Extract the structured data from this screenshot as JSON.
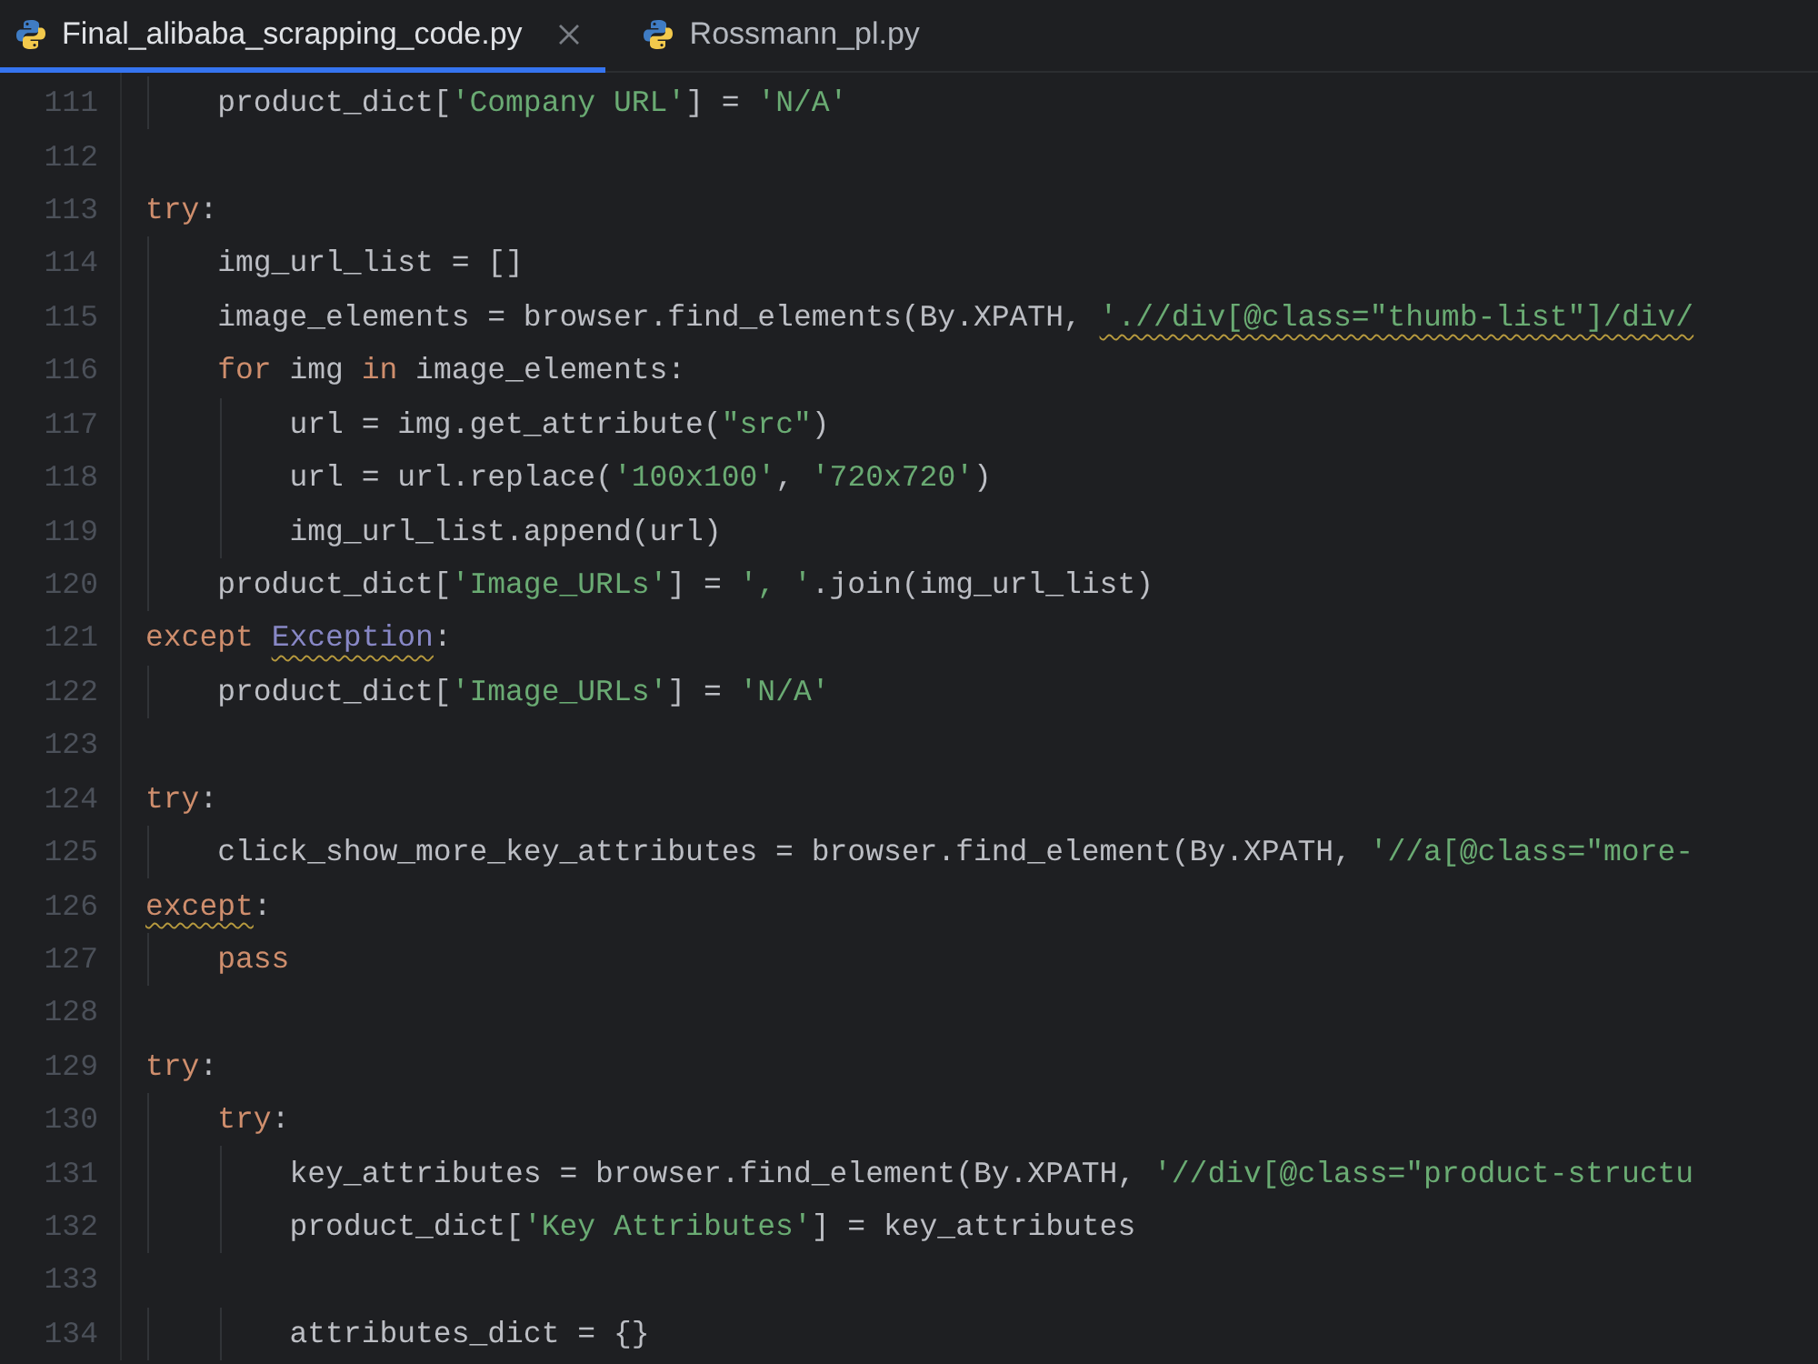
{
  "tabs": [
    {
      "label": "Final_alibaba_scrapping_code.py",
      "selected": true,
      "closable": true
    },
    {
      "label": "Rossmann_pl.py",
      "selected": false,
      "closable": false
    }
  ],
  "editor": {
    "lines": [
      {
        "number": "111",
        "tokens": [
          {
            "text": "    product_dict[",
            "kind": "plain"
          },
          {
            "text": "'Company URL'",
            "kind": "string"
          },
          {
            "text": "] = ",
            "kind": "plain"
          },
          {
            "text": "'N/A'",
            "kind": "string"
          }
        ]
      },
      {
        "number": "112"
      },
      {
        "number": "113",
        "tokens": [
          {
            "text": "try",
            "kind": "keyword"
          },
          {
            "text": ":",
            "kind": "plain"
          }
        ]
      },
      {
        "number": "114",
        "tokens": [
          {
            "text": "    img_url_list = []",
            "kind": "plain"
          }
        ]
      },
      {
        "number": "115",
        "tokens": [
          {
            "text": "    image_elements = browser.find_elements(By.XPATH, ",
            "kind": "plain"
          },
          {
            "text": "'.//div[@class=\"thumb-list\"]/div/",
            "kind": "string",
            "warning": true
          }
        ]
      },
      {
        "number": "116",
        "tokens": [
          {
            "text": "    for",
            "kind": "keyword"
          },
          {
            "text": " img ",
            "kind": "plain"
          },
          {
            "text": "in",
            "kind": "keyword"
          },
          {
            "text": " image_elements:",
            "kind": "plain"
          }
        ]
      },
      {
        "number": "117",
        "tokens": [
          {
            "text": "        url = img.get_attribute(",
            "kind": "plain"
          },
          {
            "text": "\"src\"",
            "kind": "string"
          },
          {
            "text": ")",
            "kind": "plain"
          }
        ]
      },
      {
        "number": "118",
        "tokens": [
          {
            "text": "        url = url.replace(",
            "kind": "plain"
          },
          {
            "text": "'100x100'",
            "kind": "string"
          },
          {
            "text": ", ",
            "kind": "plain"
          },
          {
            "text": "'720x720'",
            "kind": "string"
          },
          {
            "text": ")",
            "kind": "plain"
          }
        ]
      },
      {
        "number": "119",
        "tokens": [
          {
            "text": "        img_url_list.append(url)",
            "kind": "plain"
          }
        ]
      },
      {
        "number": "120",
        "tokens": [
          {
            "text": "    product_dict[",
            "kind": "plain"
          },
          {
            "text": "'Image_URLs'",
            "kind": "string"
          },
          {
            "text": "] = ",
            "kind": "plain"
          },
          {
            "text": "', '",
            "kind": "string"
          },
          {
            "text": ".join(img_url_list)",
            "kind": "plain"
          }
        ]
      },
      {
        "number": "121",
        "tokens": [
          {
            "text": "except ",
            "kind": "keyword"
          },
          {
            "text": "Exception",
            "kind": "builtin",
            "warning": true
          },
          {
            "text": ":",
            "kind": "plain"
          }
        ]
      },
      {
        "number": "122",
        "tokens": [
          {
            "text": "    product_dict[",
            "kind": "plain"
          },
          {
            "text": "'Image_URLs'",
            "kind": "string"
          },
          {
            "text": "] = ",
            "kind": "plain"
          },
          {
            "text": "'N/A'",
            "kind": "string"
          }
        ]
      },
      {
        "number": "123"
      },
      {
        "number": "124",
        "tokens": [
          {
            "text": "try",
            "kind": "keyword"
          },
          {
            "text": ":",
            "kind": "plain"
          }
        ]
      },
      {
        "number": "125",
        "tokens": [
          {
            "text": "    click_show_more_key_attributes = browser.find_element(By.XPATH, ",
            "kind": "plain"
          },
          {
            "text": "'//a[@class=\"more-",
            "kind": "string"
          }
        ]
      },
      {
        "number": "126",
        "tokens": [
          {
            "text": "except",
            "kind": "keyword",
            "warning": true
          },
          {
            "text": ":",
            "kind": "plain"
          }
        ]
      },
      {
        "number": "127",
        "tokens": [
          {
            "text": "    pass",
            "kind": "keyword"
          }
        ]
      },
      {
        "number": "128"
      },
      {
        "number": "129",
        "tokens": [
          {
            "text": "try",
            "kind": "keyword"
          },
          {
            "text": ":",
            "kind": "plain"
          }
        ]
      },
      {
        "number": "130",
        "tokens": [
          {
            "text": "    try",
            "kind": "keyword"
          },
          {
            "text": ":",
            "kind": "plain"
          }
        ]
      },
      {
        "number": "131",
        "tokens": [
          {
            "text": "        key_attributes = browser.find_element(By.XPATH, ",
            "kind": "plain"
          },
          {
            "text": "'//div[@class=\"product-structu",
            "kind": "string"
          }
        ]
      },
      {
        "number": "132",
        "tokens": [
          {
            "text": "        product_dict[",
            "kind": "plain"
          },
          {
            "text": "'Key Attributes'",
            "kind": "string"
          },
          {
            "text": "] = key_attributes",
            "kind": "plain"
          }
        ]
      },
      {
        "number": "133"
      },
      {
        "number": "134",
        "tokens": [
          {
            "text": "        attributes_dict = {}",
            "kind": "plain"
          }
        ]
      }
    ]
  }
}
